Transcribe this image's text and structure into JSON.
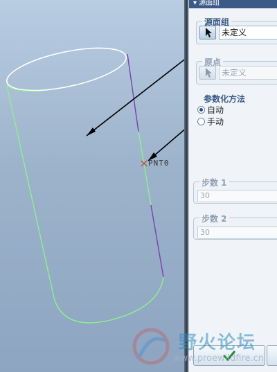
{
  "dialog": {
    "title": "源面组"
  },
  "source_surface": {
    "label": "源面组",
    "value": "未定义"
  },
  "origin": {
    "label": "原点",
    "value": "未定义"
  },
  "param_method": {
    "label": "参数化方法",
    "options": [
      {
        "label": "自动",
        "checked": true
      },
      {
        "label": "手动",
        "checked": false
      }
    ]
  },
  "step1": {
    "label": "步数 1",
    "value": "30"
  },
  "step2": {
    "label": "步数 2",
    "value": "30"
  },
  "viewport": {
    "point_label": "PNT0"
  },
  "watermark": {
    "text_cn": "野火论坛",
    "url": "www.proewildfire.cn"
  },
  "colors": {
    "accent": "#3b5a86",
    "curve_white": "#ffffff",
    "curve_green": "#8ef08e",
    "curve_purple": "#7b3fb0",
    "arrow": "#000000"
  }
}
